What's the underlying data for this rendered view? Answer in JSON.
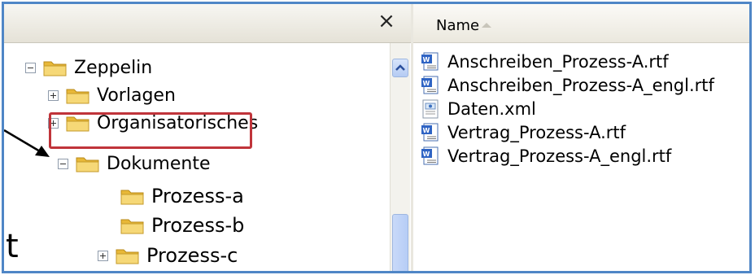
{
  "header": {
    "close_symbol": "×",
    "column_name": "Name"
  },
  "tree": {
    "nodes": [
      {
        "label": "Zeppelin",
        "expander": "minus"
      },
      {
        "label": "Vorlagen",
        "expander": "plus"
      },
      {
        "label": "Organisatorisches",
        "expander": "plus"
      },
      {
        "label": "Dokumente",
        "expander": "minus",
        "highlighted": true
      },
      {
        "label": "Prozess-a",
        "expander": "none"
      },
      {
        "label": "Prozess-b",
        "expander": "none"
      },
      {
        "label": "Prozess-c",
        "expander": "plus"
      }
    ]
  },
  "files": [
    {
      "label": "Anschreiben_Prozess-A.rtf",
      "icon": "wordpad-document-icon"
    },
    {
      "label": "Anschreiben_Prozess-A_engl.rtf",
      "icon": "wordpad-document-icon"
    },
    {
      "label": "Daten.xml",
      "icon": "xml-file-icon"
    },
    {
      "label": "Vertrag_Prozess-A.rtf",
      "icon": "wordpad-document-icon"
    },
    {
      "label": "Vertrag_Prozess-A_engl.rtf",
      "icon": "wordpad-document-icon"
    }
  ],
  "overlay": {
    "cut_text": "t"
  },
  "colors": {
    "highlight_border": "#c0343a",
    "folder": "#f2cf63",
    "window_border": "#4f86c6"
  }
}
